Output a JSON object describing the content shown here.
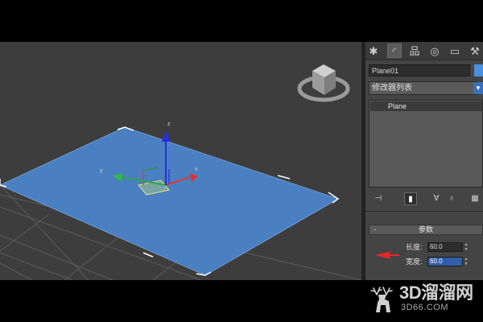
{
  "command_panel": {
    "tabs": [
      {
        "icon": "create-tab-icon",
        "glyph": "✱"
      },
      {
        "icon": "modify-tab-icon",
        "glyph": "◜"
      },
      {
        "icon": "hierarchy-tab-icon",
        "glyph": "品"
      },
      {
        "icon": "motion-tab-icon",
        "glyph": "◎"
      },
      {
        "icon": "display-tab-icon",
        "glyph": "▭"
      },
      {
        "icon": "utilities-tab-icon",
        "glyph": "⚒"
      }
    ],
    "object_name": "Plane01",
    "object_color": "#4a90e0",
    "modifier_list_label": "修改器列表",
    "modifier_stack": [
      "Plane"
    ],
    "stack_tool_icons": [
      "pin-stack-icon",
      "show-end-result-icon",
      "make-unique-icon",
      "remove-modifier-icon",
      "configure-modifier-sets-icon"
    ],
    "parameters": {
      "rollout_toggle": "-",
      "rollout_title": "参数",
      "length_label": "长度:",
      "length_value": "60.0",
      "width_label": "宽度:",
      "width_value": "60.0"
    }
  },
  "viewport": {
    "background_color": "#3d3d3d",
    "plane_color": "#4a7fc1",
    "gizmo_labels": {
      "x": "x",
      "y": "y",
      "z": "z"
    },
    "viewcube_icon": "viewcube-icon"
  },
  "watermark": {
    "brand": "3D溜溜网",
    "url": "3D66.COM",
    "icon": "deer-logo-icon"
  }
}
